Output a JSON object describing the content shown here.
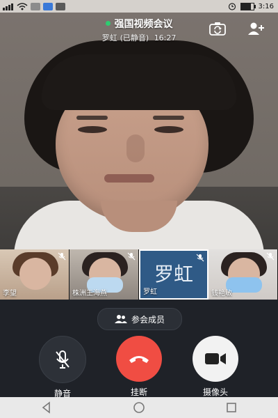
{
  "status_bar": {
    "time": "3:16",
    "icons": [
      "signal-icon",
      "wifi-icon",
      "notification-icon",
      "notification-icon",
      "notification-icon",
      "alarm-icon",
      "battery-icon"
    ],
    "battery_fraction": 0.8
  },
  "meeting": {
    "title": "强国视频会议",
    "active_speaker": "罗虹",
    "speaker_status": "(已静音)",
    "elapsed_time": "16:27"
  },
  "participants": [
    {
      "name": "李望",
      "muted": true
    },
    {
      "name": "株洲王海燕",
      "muted": true
    },
    {
      "name": "罗虹",
      "muted": true,
      "avatar_text": "罗虹"
    },
    {
      "name": "钱艳敏",
      "muted": true
    }
  ],
  "controls": {
    "members_label": "参会成员",
    "mute_label": "静音",
    "hangup_label": "挂断",
    "camera_label": "摄像头"
  },
  "colors": {
    "accent_green": "#2ecc71",
    "hangup_red": "#f04d43",
    "background_dark": "#1f2228"
  },
  "navbar": {
    "buttons": [
      "back-icon",
      "home-icon",
      "recent-apps-icon"
    ]
  }
}
